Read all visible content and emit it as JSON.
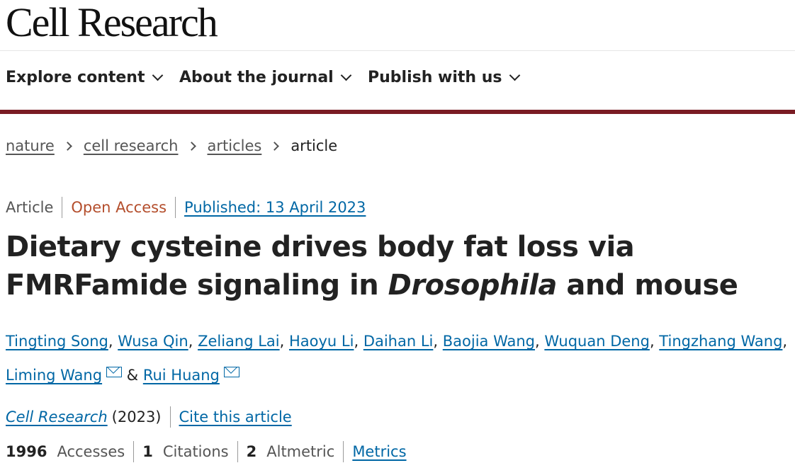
{
  "header": {
    "logo_text": "Cell Research"
  },
  "nav": {
    "items": [
      {
        "label": "Explore content"
      },
      {
        "label": "About the journal"
      },
      {
        "label": "Publish with us"
      }
    ],
    "accent_color": "#7a1c24"
  },
  "breadcrumb": {
    "items": [
      "nature",
      "cell research",
      "articles"
    ],
    "current": "article"
  },
  "article": {
    "type": "Article",
    "access": "Open Access",
    "published": "Published: 13 April 2023",
    "title_part1": "Dietary cysteine drives body fat loss via FMRFamide signaling in ",
    "title_italic": "Drosophila",
    "title_part2": " and mouse",
    "authors": [
      "Tingting Song",
      "Wusa Qin",
      "Zeliang Lai",
      "Haoyu Li",
      "Daihan Li",
      "Baojia Wang",
      "Wuquan Deng",
      "Tingzhang Wang",
      "Liming Wang",
      "Rui Huang"
    ],
    "separator": ", ",
    "ampersand": " & ",
    "journal": "Cell Research",
    "year": "(2023)",
    "cite_label": "Cite this article",
    "metrics": {
      "accesses_value": "1996",
      "accesses_label": "Accesses",
      "citations_value": "1",
      "citations_label": "Citations",
      "altmetric_value": "2",
      "altmetric_label": "Altmetric",
      "metrics_link": "Metrics"
    },
    "link_color": "#0067a5",
    "open_access_color": "#b44e2c"
  }
}
